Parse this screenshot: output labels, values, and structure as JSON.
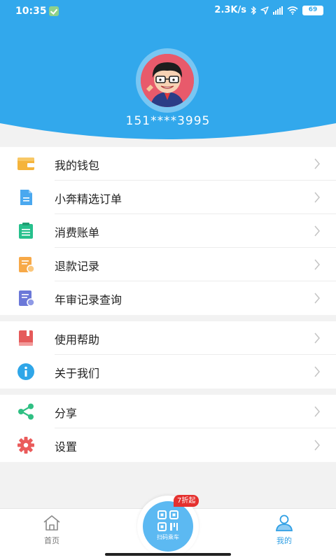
{
  "status": {
    "time": "10:35",
    "speed": "2.3K/s",
    "battery": "69"
  },
  "profile": {
    "phone": "151****3995"
  },
  "menu_group_1": [
    {
      "label": "我的钱包",
      "icon": "wallet-icon",
      "color": "#f5b43c"
    },
    {
      "label": "小奔精选订单",
      "icon": "document-icon",
      "color": "#4aa8ef"
    },
    {
      "label": "消费账单",
      "icon": "bill-icon",
      "color": "#26c08c"
    },
    {
      "label": "退款记录",
      "icon": "refund-icon",
      "color": "#f7a948"
    },
    {
      "label": "年审记录查询",
      "icon": "record-search-icon",
      "color": "#6b78d8"
    }
  ],
  "menu_group_2": [
    {
      "label": "使用帮助",
      "icon": "help-book-icon",
      "color": "#e55a5a"
    },
    {
      "label": "关于我们",
      "icon": "info-icon",
      "color": "#2fa6e8"
    }
  ],
  "menu_group_3": [
    {
      "label": "分享",
      "icon": "share-icon",
      "color": "#2fbf83"
    },
    {
      "label": "设置",
      "icon": "gear-icon",
      "color": "#ea5b5b"
    }
  ],
  "nav": {
    "home": "首页",
    "scan": "扫码乘车",
    "badge": "7折起",
    "mine": "我的"
  },
  "colors": {
    "header": "#32a8ec",
    "accent": "#2f9fe4"
  }
}
